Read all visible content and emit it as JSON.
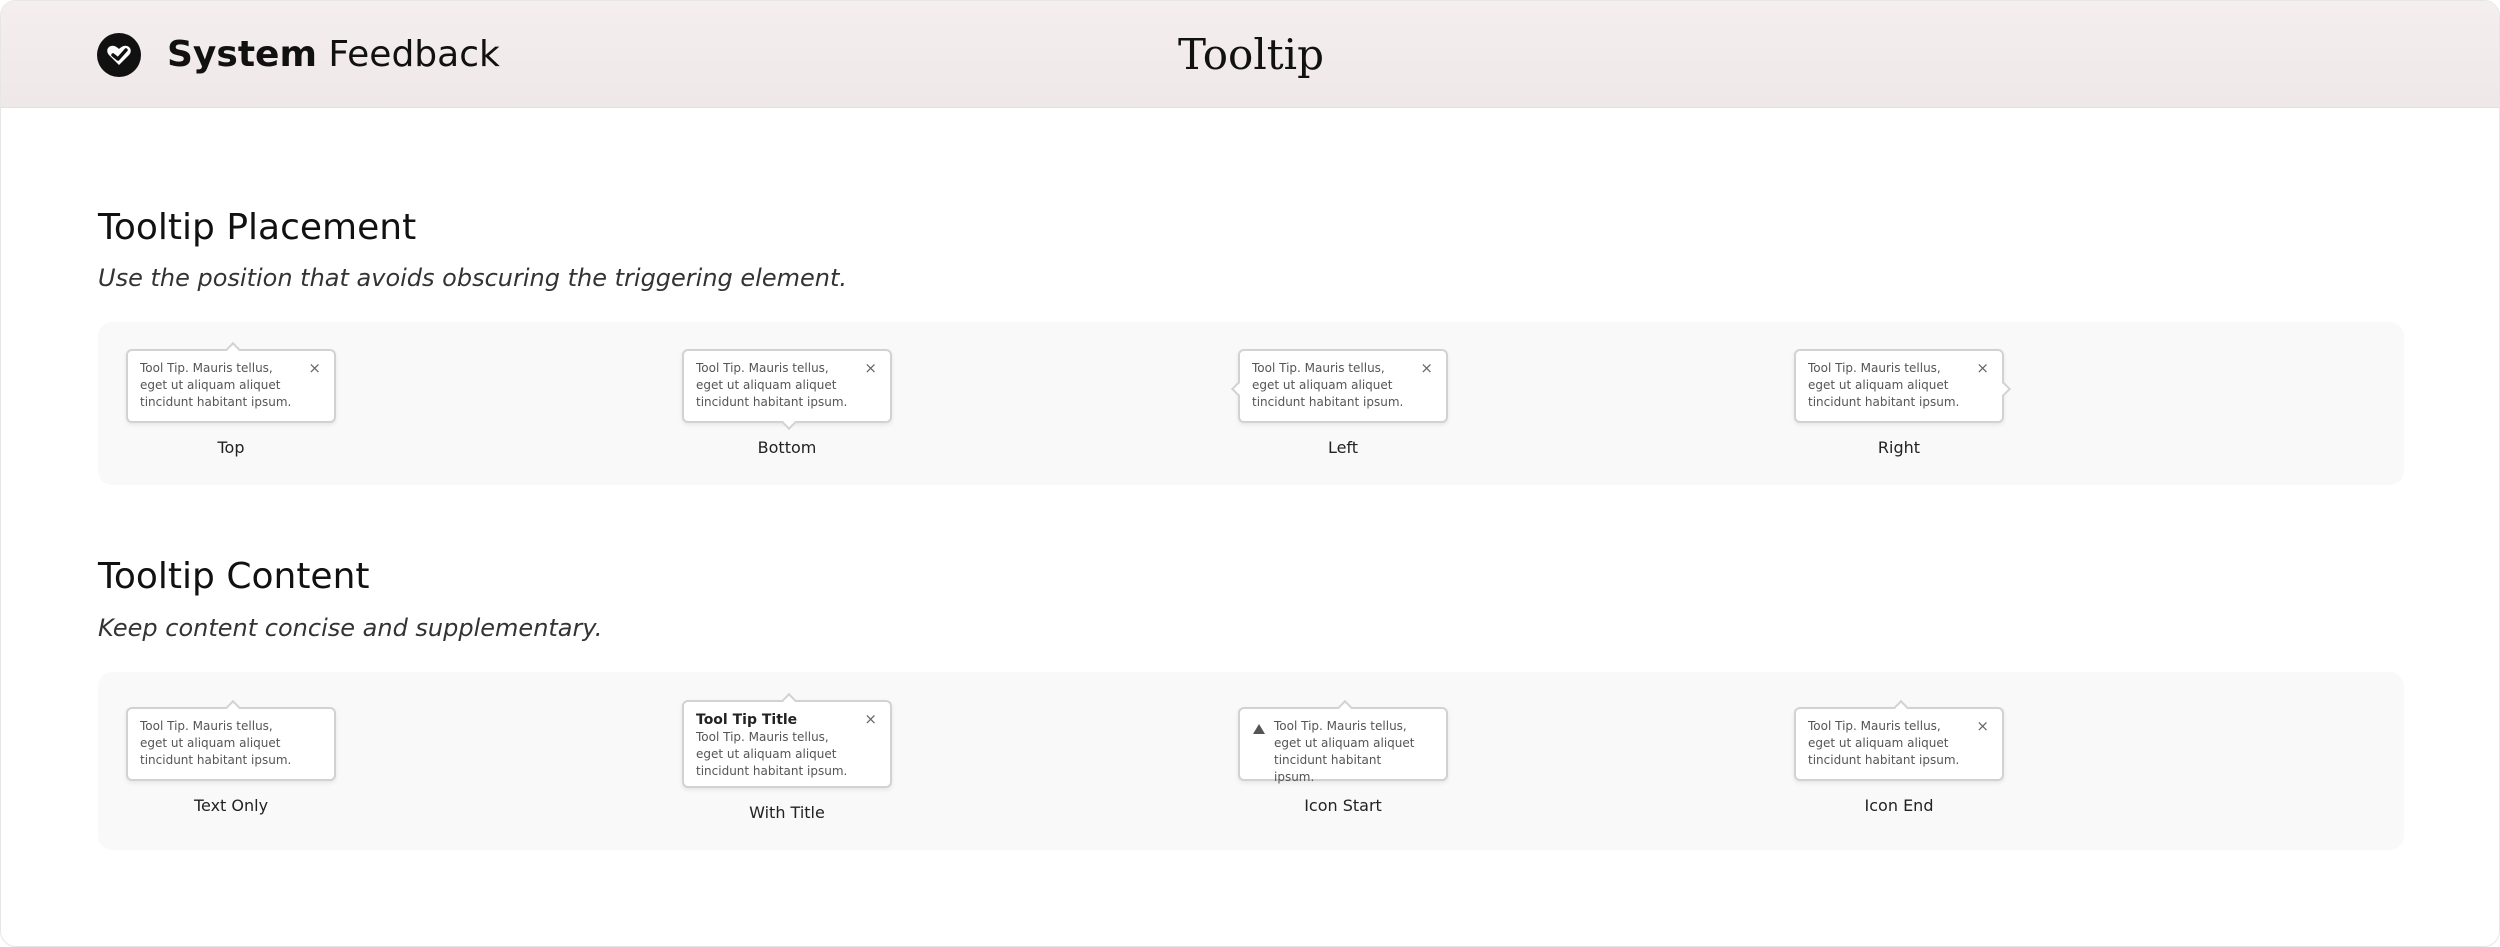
{
  "header": {
    "brand_bold": "System",
    "brand_light": "Feedback",
    "page_title": "Tooltip",
    "logo_icon": "heart-check-icon"
  },
  "placement": {
    "title": "Tooltip Placement",
    "subtitle": "Use the position that avoids obscuring the triggering element.",
    "items": [
      {
        "label": "Top",
        "text": "Tool Tip. Mauris tellus, eget ut aliquam aliquet tincidunt habitant ipsum.",
        "close": "×"
      },
      {
        "label": "Bottom",
        "text": "Tool Tip. Mauris tellus, eget ut aliquam aliquet tincidunt habitant ipsum.",
        "close": "×"
      },
      {
        "label": "Left",
        "text": "Tool Tip. Mauris tellus, eget ut aliquam aliquet tincidunt habitant ipsum.",
        "close": "×"
      },
      {
        "label": "Right",
        "text": "Tool Tip. Mauris tellus, eget ut aliquam aliquet tincidunt habitant ipsum.",
        "close": "×"
      }
    ]
  },
  "content": {
    "title": "Tooltip Content",
    "subtitle": "Keep content concise and supplementary.",
    "items": [
      {
        "label": "Text Only",
        "text": "Tool Tip. Mauris tellus, eget ut aliquam aliquet tincidunt habitant ipsum."
      },
      {
        "label": "With Title",
        "title": "Tool Tip Title",
        "text": "Tool Tip. Mauris tellus, eget ut aliquam aliquet tincidunt habitant ipsum.",
        "close": "×"
      },
      {
        "label": "Icon Start",
        "text": "Tool Tip. Mauris tellus, eget ut aliquam aliquet tincidunt habitant ipsum.",
        "icon": "warning-icon"
      },
      {
        "label": "Icon End",
        "text": "Tool Tip. Mauris tellus, eget ut aliquam aliquet tincidunt habitant ipsum.",
        "close": "×"
      }
    ]
  },
  "colors": {
    "header_bg": "#f3eded",
    "panel_bg": "#f9f9f9",
    "tooltip_border": "#d2d2d2",
    "text_dark": "#111111"
  }
}
